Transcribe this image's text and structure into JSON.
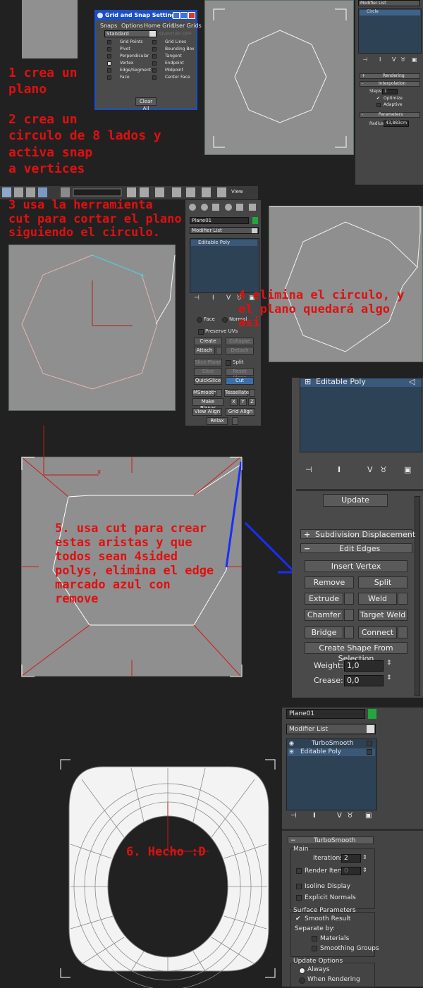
{
  "steps": {
    "s1": "1 crea un\nplano",
    "s2": "2 crea un\ncirculo de 8 lados y\nactiva snap\na vertices",
    "s3": "3 usa la herramienta\ncut para cortar el plano\nsiguiendo el circulo.",
    "s4": "4 elimina el circulo, y\nel plano quedará algo\nasi",
    "s5": "5. usa cut para crear\nestas aristas y que\ntodos sean 4sided\npolys, elimina el edge\nmarcado azul con\nremove",
    "s6": "6. Hecho :D"
  },
  "snap_dialog": {
    "title": "Grid and Snap Settings",
    "tabs": [
      "Snaps",
      "Options",
      "Home Grid",
      "User Grids"
    ],
    "dropdown": "Standard",
    "dropdown_right": "Override OFF",
    "left_items": [
      {
        "label": "Grid Points",
        "checked": false
      },
      {
        "label": "Pivot",
        "checked": false
      },
      {
        "label": "Perpendicular",
        "checked": false
      },
      {
        "label": "Vertex",
        "checked": true
      },
      {
        "label": "Edge/Segment",
        "checked": false
      },
      {
        "label": "Face",
        "checked": false
      }
    ],
    "right_items": [
      {
        "label": "Grid Lines",
        "checked": false
      },
      {
        "label": "Bounding Box",
        "checked": false
      },
      {
        "label": "Tangent",
        "checked": false
      },
      {
        "label": "Endpoint",
        "checked": false
      },
      {
        "label": "Midpoint",
        "checked": false
      },
      {
        "label": "Center Face",
        "checked": false
      }
    ],
    "clear_all": "Clear All"
  },
  "panel1": {
    "modifier_list": "Modifier List",
    "stack_item": "Circle",
    "rollout_rendering": "Rendering",
    "rollout_interpolation": "Interpolation",
    "steps_label": "Steps:",
    "steps_value": "1",
    "optimize": "Optimize",
    "adaptive": "Adaptive",
    "rollout_parameters": "Parameters",
    "radius_label": "Radius:",
    "radius_value": "43,883cm"
  },
  "toolbar": {
    "view_label": "View"
  },
  "panel2": {
    "object_name": "Plane01",
    "modifier_list": "Modifier List",
    "stack_item": "Editable Poly",
    "face": "Face",
    "normal": "Normal",
    "preserve_uvs": "Preserve UVs",
    "create": "Create",
    "collapse": "Collapse",
    "attach": "Attach",
    "detach": "Detach",
    "slice_plane": "Slice Plane",
    "split": "Split",
    "slice": "Slice",
    "reset_plane": "Reset Plane",
    "quickslice": "QuickSlice",
    "cut": "Cut",
    "msmooth": "MSmooth",
    "tessellate": "Tessellate",
    "make_planar": "Make Planar",
    "x": "X",
    "y": "Y",
    "z": "Z",
    "view_align": "View Align",
    "grid_align": "Grid Align",
    "relax": "Relax"
  },
  "panel3": {
    "stack_item": "Editable Poly",
    "update": "Update",
    "subdiv": "Subdivision Displacement",
    "edit_edges": "Edit Edges",
    "insert_vertex": "Insert Vertex",
    "remove": "Remove",
    "split": "Split",
    "extrude": "Extrude",
    "weld": "Weld",
    "chamfer": "Chamfer",
    "target_weld": "Target Weld",
    "bridge": "Bridge",
    "connect": "Connect",
    "create_shape": "Create Shape From Selection",
    "weight_label": "Weight:",
    "weight_value": "1,0",
    "crease_label": "Crease:",
    "crease_value": "0,0"
  },
  "panel4": {
    "object_name": "Plane01",
    "modifier_list": "Modifier List",
    "stack_items": [
      "TurboSmooth",
      "Editable Poly"
    ],
    "rollout": "TurboSmooth",
    "main": "Main",
    "iterations_label": "Iterations:",
    "iterations_value": "2",
    "render_iters": "Render Iters:",
    "render_iters_value": "0",
    "isoline": "Isoline Display",
    "explicit_normals": "Explicit Normals",
    "surface_params": "Surface Parameters",
    "smooth_result": "Smooth Result",
    "separate_by": "Separate by:",
    "materials": "Materials",
    "smoothing_groups": "Smoothing Groups",
    "update_options": "Update Options",
    "always": "Always",
    "when_rendering": "When Rendering"
  },
  "colors": {
    "step_text": "#e01010",
    "cut_line": "#40d0e0",
    "blue_edge": "#1a2dff",
    "selection": "#3c5a78",
    "dialog_title": "#1c4fc4"
  }
}
